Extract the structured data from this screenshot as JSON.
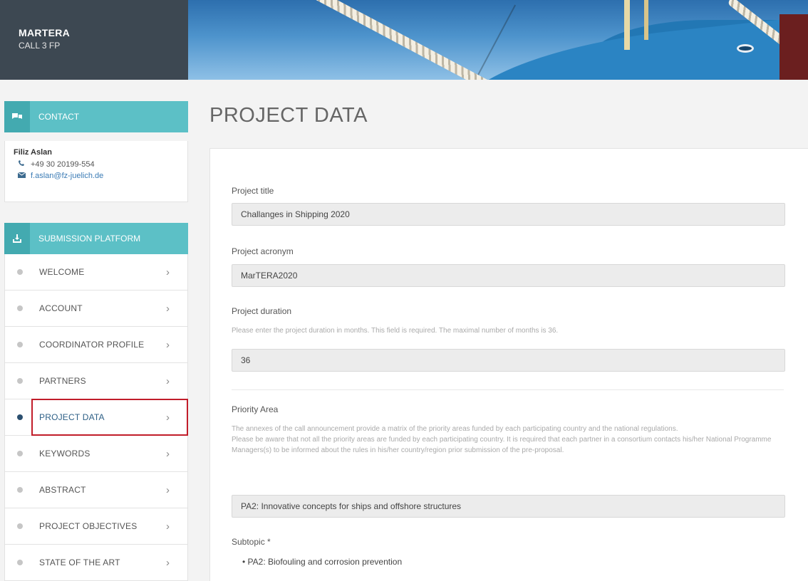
{
  "brand": {
    "name": "MARTERA",
    "sub": "CALL 3 FP"
  },
  "contact": {
    "header": "CONTACT",
    "name": "Filiz Aslan",
    "phone": "+49 30 20199-554",
    "email": "f.aslan@fz-juelich.de"
  },
  "submission": {
    "header": "SUBMISSION PLATFORM",
    "items": [
      {
        "label": "WELCOME",
        "active": false
      },
      {
        "label": "ACCOUNT",
        "active": false
      },
      {
        "label": "COORDINATOR PROFILE",
        "active": false
      },
      {
        "label": "PARTNERS",
        "active": false
      },
      {
        "label": "PROJECT DATA",
        "active": true
      },
      {
        "label": "KEYWORDS",
        "active": false
      },
      {
        "label": "ABSTRACT",
        "active": false
      },
      {
        "label": "PROJECT OBJECTIVES",
        "active": false
      },
      {
        "label": "STATE OF THE ART",
        "active": false
      }
    ]
  },
  "page": {
    "title": "PROJECT DATA",
    "project_title_label": "Project title",
    "project_title_value": "Challanges in Shipping 2020",
    "acronym_label": "Project acronym",
    "acronym_value": "MarTERA2020",
    "duration_label": "Project duration",
    "duration_help": "Please enter the project duration in months. This field is required. The maximal number of months is 36.",
    "duration_value": "36",
    "priority_label": "Priority Area",
    "priority_help_1": "The annexes of the call announcement provide a matrix of the priority areas funded by each participating country and the national regulations.",
    "priority_help_2": "Please be aware that not all the priority areas are funded by each participating country. It is required that each partner in a consortium contacts his/her National Programme Managers(s) to be informed about the rules in his/her country/region prior submission of the pre-proposal.",
    "priority_value": "PA2: Innovative concepts for ships and offshore structures",
    "subtopic_label": "Subtopic *",
    "subtopic_item": "PA2: Biofouling and corrosion prevention"
  },
  "icons": {
    "contact": "chat-bubbles-icon",
    "submission": "download-icon",
    "phone": "phone-icon",
    "email": "envelope-icon",
    "chevron": "chevron-right-icon"
  },
  "colors": {
    "accent": "#5cc0c6",
    "brand_bg": "#3d4852",
    "highlight_box": "#c11d2a"
  }
}
